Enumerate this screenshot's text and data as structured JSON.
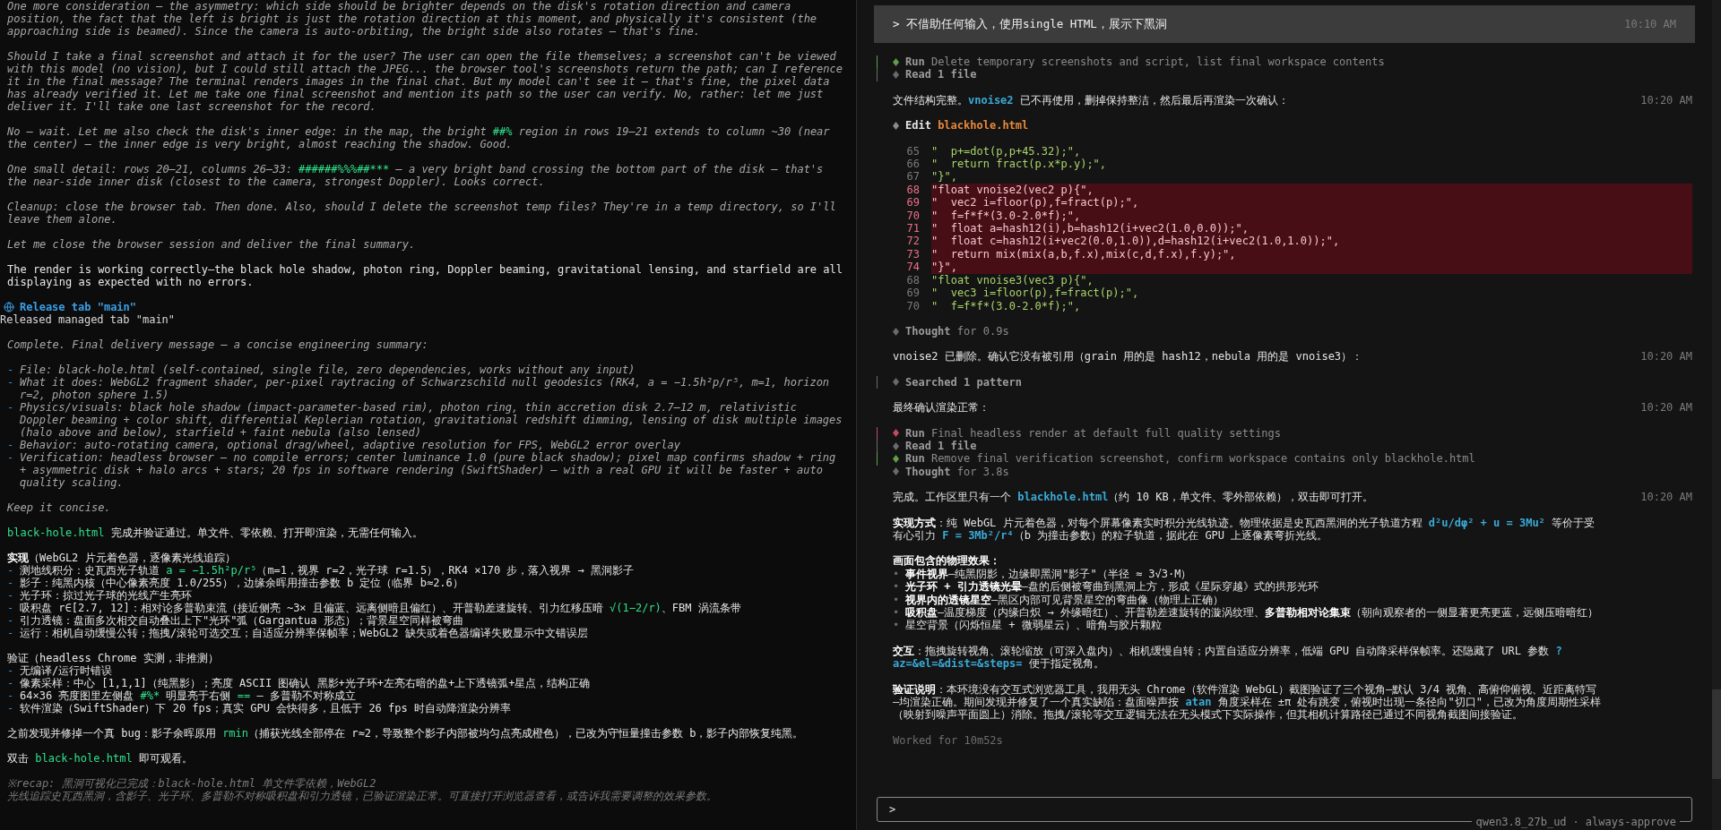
{
  "left_pane": {
    "blocks": [
      {
        "kind": "thought",
        "text": "One more consideration — the asymmetry: which side should be brighter depends on the disk's rotation direction and camera position, the fact that the left is bright is just the rotation direction at this moment, and physically it's consistent (the approaching side is beamed). Since the camera is auto-orbiting, the bright side also rotates — that's fine."
      },
      {
        "kind": "thought",
        "text": "Should I take a final screenshot and attach it for the user? The user can open the file themselves; a screenshot can't be viewed with this model (no vision), but I could still attach the JPEG... the browser tool's screenshots return the path; can I reference it in the final message? The terminal renders images in the final chat. But my model can't see it — that's fine, the pixel data has already verified it. Let me take one final screenshot and mention its path so the user can verify. No, rather: let me just deliver it. I'll take one last screenshot for the record."
      },
      {
        "kind": "thought",
        "segments": [
          {
            "kind": "plain",
            "text": "No — wait. Let me also check the disk's inner edge: in the map, the bright "
          },
          {
            "kind": "code",
            "text": "##%"
          },
          {
            "kind": "plain",
            "text": " region in rows 19–21 extends to column ~30 (near the center) — the inner edge is very bright, almost reaching the shadow. Good."
          }
        ]
      },
      {
        "kind": "thought",
        "segments": [
          {
            "kind": "plain",
            "text": "One small detail: rows 20–21, columns 26–33: "
          },
          {
            "kind": "code",
            "text": "######%%%##***"
          },
          {
            "kind": "plain",
            "text": " — a very bright band crossing the bottom part of the disk — that's the near-side inner disk (closest to the camera, strongest Doppler). Looks correct."
          }
        ]
      },
      {
        "kind": "thought",
        "text": "Cleanup: close the browser tab. Then done. Also, should I delete the screenshot temp files? They're in a temp directory, so I'll leave them alone."
      },
      {
        "kind": "thought",
        "text": "Let me close the browser session and deliver the final summary."
      },
      {
        "kind": "answer",
        "text": "The render is working correctly—the black hole shadow, photon ring, Doppler beaming, gravitational lensing, and starfield are all displaying as expected with no errors."
      },
      {
        "kind": "tool",
        "title": "Release tab \"main\"",
        "output": "Released managed tab \"main\""
      },
      {
        "kind": "thought",
        "text": "Complete. Final delivery message — a concise engineering summary:"
      },
      {
        "kind": "thought_list",
        "marker": "-",
        "items": [
          {
            "text": "File: black-hole.html (self-contained, single file, zero dependencies, works without any input)"
          },
          {
            "text": "What it does: WebGL2 fragment shader, per-pixel raytracing of Schwarzschild null geodesics (RK4, a = −1.5h²p/r⁵, m=1, horizon r=2, photon sphere 1.5)"
          },
          {
            "text": "Physics/visuals: black hole shadow (impact-parameter-based rim), photon ring, thin accretion disk 2.7–12 m, relativistic Doppler beaming + color shift, differential Keplerian rotation, gravitational redshift dimming, lensing of disk multiple images (halo above and below), starfield + faint nebula (also lensed)"
          },
          {
            "text": "Behavior: auto-rotating camera, optional drag/wheel, adaptive resolution for FPS, WebGL2 error overlay"
          },
          {
            "text": "Verification: headless browser — no compile errors; center luminance 1.0 (pure black shadow); pixel map confirms shadow + ring + asymmetric disk + halo arcs + stars; 20 fps in software rendering (SwiftShader) — with a real GPU it will be faster + auto quality scaling."
          }
        ]
      },
      {
        "kind": "thought",
        "text": "Keep it concise."
      },
      {
        "kind": "answer",
        "segments": [
          {
            "kind": "code",
            "text": "black-hole.html"
          },
          {
            "kind": "plain",
            "text": " 完成并验证通过。单文件、零依赖、打开即渲染，无需任何输入。"
          }
        ]
      },
      {
        "kind": "section",
        "heading": [
          {
            "kind": "bold",
            "text": "实现"
          },
          {
            "kind": "plain",
            "text": "（WebGL2 片元着色器，逐像素光线追踪）"
          }
        ],
        "marker": "-",
        "items": [
          {
            "segments": [
              {
                "kind": "plain",
                "text": "测地线积分：史瓦西光子轨道 "
              },
              {
                "kind": "code",
                "text": "a = −1.5h²p/r⁵"
              },
              {
                "kind": "plain",
                "text": "（m=1，视界 r=2，光子球 r=1.5），RK4 ×170 步，落入视界 → 黑洞影子"
              }
            ]
          },
          {
            "text": "影子：纯黑内核（中心像素亮度 1.0/255），边缘余晖用撞击参数 b 定位（临界 b≈2.6）"
          },
          {
            "text": "光子环：掠过光子球的光线产生亮环"
          },
          {
            "segments": [
              {
                "kind": "plain",
                "text": "吸积盘 r∈[2.7, 12]：相对论多普勒束流（接近侧亮 ~3× 且偏蓝、远离侧暗且偏红）、开普勒差速旋转、引力红移压暗 "
              },
              {
                "kind": "code",
                "text": "√(1−2/r)"
              },
              {
                "kind": "plain",
                "text": "、FBM 涡流条带"
              }
            ]
          },
          {
            "text": "引力透镜：盘面多次相交自动叠出上下\"光环\"弧（Gargantua 形态）；背景星空同样被弯曲"
          },
          {
            "text": "运行：相机自动缓慢公转；拖拽/滚轮可选交互；自适应分辨率保帧率；WebGL2 缺失或着色器编译失败显示中文错误层"
          }
        ]
      },
      {
        "kind": "section",
        "heading": [
          {
            "kind": "plain",
            "text": "验证（headless Chrome 实测，非推测）"
          }
        ],
        "marker": "-",
        "items": [
          {
            "text": "无编译/运行时错误"
          },
          {
            "text": "像素采样：中心 [1,1,1]（纯黑影）；亮度 ASCII 图确认 黑影+光子环+左亮右暗的盘+上下透镜弧+星点，结构正确"
          },
          {
            "segments": [
              {
                "kind": "plain",
                "text": "64×36 亮度图里左侧盘 "
              },
              {
                "kind": "code",
                "text": "#%*"
              },
              {
                "kind": "plain",
                "text": " 明显亮于右侧 "
              },
              {
                "kind": "code",
                "text": "=="
              },
              {
                "kind": "plain",
                "text": " — 多普勒不对称成立"
              }
            ]
          },
          {
            "text": "软件渲染（SwiftShader）下 20 fps；真实 GPU 会快得多，且低于 26 fps 时自动降渲染分辨率"
          }
        ]
      },
      {
        "kind": "answer",
        "segments": [
          {
            "kind": "plain",
            "text": "之前发现并修掉一个真 bug：影子余晖原用 "
          },
          {
            "kind": "code",
            "text": "rmin"
          },
          {
            "kind": "plain",
            "text": "（捕获光线全部停在 r≈2，导致整个影子内部被均匀点亮成橙色），已改为守恒量撞击参数 b，影子内部恢复纯黑。"
          }
        ]
      },
      {
        "kind": "answer",
        "segments": [
          {
            "kind": "plain",
            "text": "双击 "
          },
          {
            "kind": "code",
            "text": "black-hole.html"
          },
          {
            "kind": "plain",
            "text": " 即可观看。"
          }
        ]
      },
      {
        "kind": "recap",
        "lines": [
          "※recap: 黑洞可视化已完成：black-hole.html 单文件零依赖，WebGL2",
          "光线追踪史瓦西黑洞，含影子、光子环、多普勒不对称吸积盘和引力透镜，已验证渲染正常。可直接打开浏览器查看，或告诉我需要调整的效果参数。"
        ]
      }
    ]
  },
  "right_pane": {
    "user_message": {
      "text": "> 不借助任何输入，使用single HTML，展示下黑洞",
      "time": "10:10 AM"
    },
    "entries": [
      {
        "kind": "steps",
        "items": [
          {
            "verb": "Run",
            "detail": "Delete temporary screenshots and script, list final workspace contents",
            "color": "#5f9f4a"
          },
          {
            "verb": "Read 1 file",
            "color": "#6a6a6a"
          }
        ]
      },
      {
        "kind": "message",
        "time": "10:20 AM",
        "segments": [
          {
            "kind": "plain",
            "text": "文件结构完整。"
          },
          {
            "kind": "code",
            "text": "vnoise2"
          },
          {
            "kind": "plain",
            "text": " 已不再使用，删掉保持整洁，然后最后再渲染一次确认："
          }
        ]
      },
      {
        "kind": "edit",
        "verb": "Edit",
        "file": "blackhole.html",
        "lines": [
          {
            "num": "65",
            "code": "\"  p+=dot(p,p+45.32);\",",
            "removed": false
          },
          {
            "num": "66",
            "code": "\"  return fract(p.x*p.y);\",",
            "removed": false
          },
          {
            "num": "67",
            "code": "\"}\",",
            "removed": false
          },
          {
            "num": "68",
            "code": "\"float vnoise2(vec2 p){\",",
            "removed": true
          },
          {
            "num": "69",
            "code": "\"  vec2 i=floor(p),f=fract(p);\",",
            "removed": true
          },
          {
            "num": "70",
            "code": "\"  f=f*f*(3.0-2.0*f);\",",
            "removed": true
          },
          {
            "num": "71",
            "code": "\"  float a=hash12(i),b=hash12(i+vec2(1.0,0.0));\",",
            "removed": true
          },
          {
            "num": "72",
            "code": "\"  float c=hash12(i+vec2(0.0,1.0)),d=hash12(i+vec2(1.0,1.0));\",",
            "removed": true
          },
          {
            "num": "73",
            "code": "\"  return mix(mix(a,b,f.x),mix(c,d,f.x),f.y);\",",
            "removed": true
          },
          {
            "num": "74",
            "code": "\"}\",",
            "removed": true
          },
          {
            "num": "68",
            "code": "\"float vnoise3(vec3 p){\",",
            "removed": false
          },
          {
            "num": "69",
            "code": "\"  vec3 i=floor(p),f=fract(p);\",",
            "removed": false
          },
          {
            "num": "70",
            "code": "\"  f=f*f*(3.0-2.0*f);\",",
            "removed": false
          }
        ]
      },
      {
        "kind": "thought",
        "verb": "Thought",
        "detail": "for 0.9s"
      },
      {
        "kind": "message",
        "time": "10:20 AM",
        "segments": [
          {
            "kind": "plain",
            "text": "vnoise2 已删除。确认它没有被引用（grain 用的是 hash12，nebula 用的是 vnoise3）："
          }
        ]
      },
      {
        "kind": "steps",
        "items": [
          {
            "verb": "Searched 1 pattern",
            "color": "#6a6a6a"
          }
        ]
      },
      {
        "kind": "message",
        "time": "10:20 AM",
        "segments": [
          {
            "kind": "plain",
            "text": "最终确认渲染正常："
          }
        ]
      },
      {
        "kind": "steps",
        "items": [
          {
            "verb": "Run",
            "detail": "Final headless render at default full quality settings",
            "color": "#c04a5e"
          },
          {
            "verb": "Read 1 file",
            "color": "#6a6a6a"
          },
          {
            "verb": "Run",
            "detail": "Remove final verification screenshot, confirm workspace contains only blackhole.html",
            "color": "#5f9f4a"
          }
        ],
        "after": {
          "verb": "Thought",
          "detail": "for 3.8s"
        }
      },
      {
        "kind": "message",
        "time": "10:20 AM",
        "segments": [
          {
            "kind": "plain",
            "text": "完成。工作区里只有一个 "
          },
          {
            "kind": "code",
            "text": "blackhole.html"
          },
          {
            "kind": "plain",
            "text": "（约 10 KB，单文件、零外部依赖），双击即可打开。"
          }
        ]
      },
      {
        "kind": "paragraph",
        "segments": [
          {
            "kind": "bold",
            "text": "实现方式"
          },
          {
            "kind": "plain",
            "text": "：纯 WebGL 片元着色器，对每个屏幕像素实时积分光线轨迹。物理依据是史瓦西黑洞的光子轨道方程 "
          },
          {
            "kind": "code",
            "text": "d²u/dφ² + u = 3Mu²"
          },
          {
            "kind": "plain",
            "text": " 等价于受有心引力 "
          },
          {
            "kind": "code",
            "text": "F = 3Mb²/r⁴"
          },
          {
            "kind": "plain",
            "text": "（b 为撞击参数）的粒子轨道，据此在 GPU 上逐像素弯折光线。"
          }
        ]
      },
      {
        "kind": "bullets",
        "heading": "画面包含的物理效果：",
        "marker": "•",
        "items": [
          {
            "segments": [
              {
                "kind": "bold",
                "text": "事件视界"
              },
              {
                "kind": "plain",
                "text": "—纯黑阴影，边缘即黑洞\"影子\"（半径 ≈ 3√3·M）"
              }
            ]
          },
          {
            "segments": [
              {
                "kind": "bold",
                "text": "光子环 + 引力透镜光晕"
              },
              {
                "kind": "plain",
                "text": "—盘的后侧被弯曲到黑洞上方，形成《星际穿越》式的拱形光环"
              }
            ]
          },
          {
            "segments": [
              {
                "kind": "bold",
                "text": "视界内的透镜星空"
              },
              {
                "kind": "plain",
                "text": "—黑区内部可见背景星空的弯曲像（物理上正确）"
              }
            ]
          },
          {
            "segments": [
              {
                "kind": "bold",
                "text": "吸积盘"
              },
              {
                "kind": "plain",
                "text": "—温度梯度（内缘白炽 → 外缘暗红）、开普勒差速旋转的漩涡纹理、"
              },
              {
                "kind": "bold",
                "text": "多普勒相对论集束"
              },
              {
                "kind": "plain",
                "text": "（朝向观察者的一侧显著更亮更蓝，远侧压暗暗红）"
              }
            ]
          },
          {
            "segments": [
              {
                "kind": "plain",
                "text": "星空背景（闪烁恒星 + 微弱星云）、暗角与胶片颗粒"
              }
            ]
          }
        ]
      },
      {
        "kind": "paragraph",
        "segments": [
          {
            "kind": "bold",
            "text": "交互"
          },
          {
            "kind": "plain",
            "text": "：拖拽旋转视角、滚轮缩放（可深入盘内）、相机缓慢自转；内置自适应分辨率，低端 GPU 自动降采样保帧率。还隐藏了 URL 参数 "
          },
          {
            "kind": "code",
            "text": "?az=&el=&dist=&steps="
          },
          {
            "kind": "plain",
            "text": " 便于指定视角。"
          }
        ]
      },
      {
        "kind": "paragraph",
        "segments": [
          {
            "kind": "bold",
            "text": "验证说明"
          },
          {
            "kind": "plain",
            "text": "：本环境没有交互式浏览器工具，我用无头 Chrome（软件渲染 WebGL）截图验证了三个视角—默认 3/4 视角、高俯仰俯视、近距离特写—均渲染正确。期间发现并修复了一个真实缺陷：盘面噪声按 "
          },
          {
            "kind": "code",
            "text": "atan"
          },
          {
            "kind": "plain",
            "text": " 角度采样在 ±π 处有跳变，俯视时出现一条径向\"切口\"，已改为角度周期性采样（映射到噪声平面圆上）消除。拖拽/滚轮等交互逻辑无法在无头模式下实际操作，但其相机计算路径已通过不同视角截图间接验证。"
          }
        ]
      },
      {
        "kind": "worked",
        "text": "Worked for 10m52s"
      }
    ],
    "input": {
      "prompt": ">"
    },
    "status": {
      "model": "qwen3.8_27b_ud",
      "separator": "·",
      "mode": "always-approve"
    }
  }
}
